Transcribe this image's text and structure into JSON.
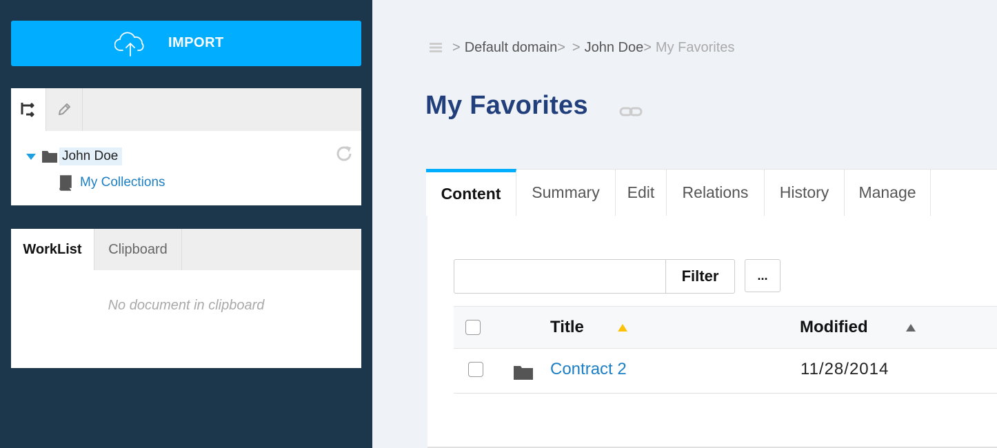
{
  "sidebar": {
    "import_label": "IMPORT",
    "tree": {
      "root_label": "John Doe",
      "child_label": "My Collections"
    },
    "clipboard": {
      "tabs": [
        "WorkList",
        "Clipboard"
      ],
      "empty_message": "No document in clipboard"
    }
  },
  "breadcrumb": {
    "items": [
      "Default domain",
      "John Doe"
    ],
    "current": "My Favorites",
    "separator": ">"
  },
  "page": {
    "title": "My Favorites"
  },
  "tabs": [
    "Content",
    "Summary",
    "Edit",
    "Relations",
    "History",
    "Manage"
  ],
  "toolbar": {
    "filter_label": "Filter",
    "more_label": "...",
    "filter_value": ""
  },
  "grid": {
    "columns": [
      "Title",
      "Modified"
    ],
    "rows": [
      {
        "title": "Contract 2",
        "modified": "11/28/2014"
      }
    ]
  },
  "colors": {
    "sidebar_bg": "#1c364c",
    "accent": "#00adff",
    "title": "#213f7a",
    "link": "#1c7fc4",
    "sort_active": "#ffc107"
  }
}
